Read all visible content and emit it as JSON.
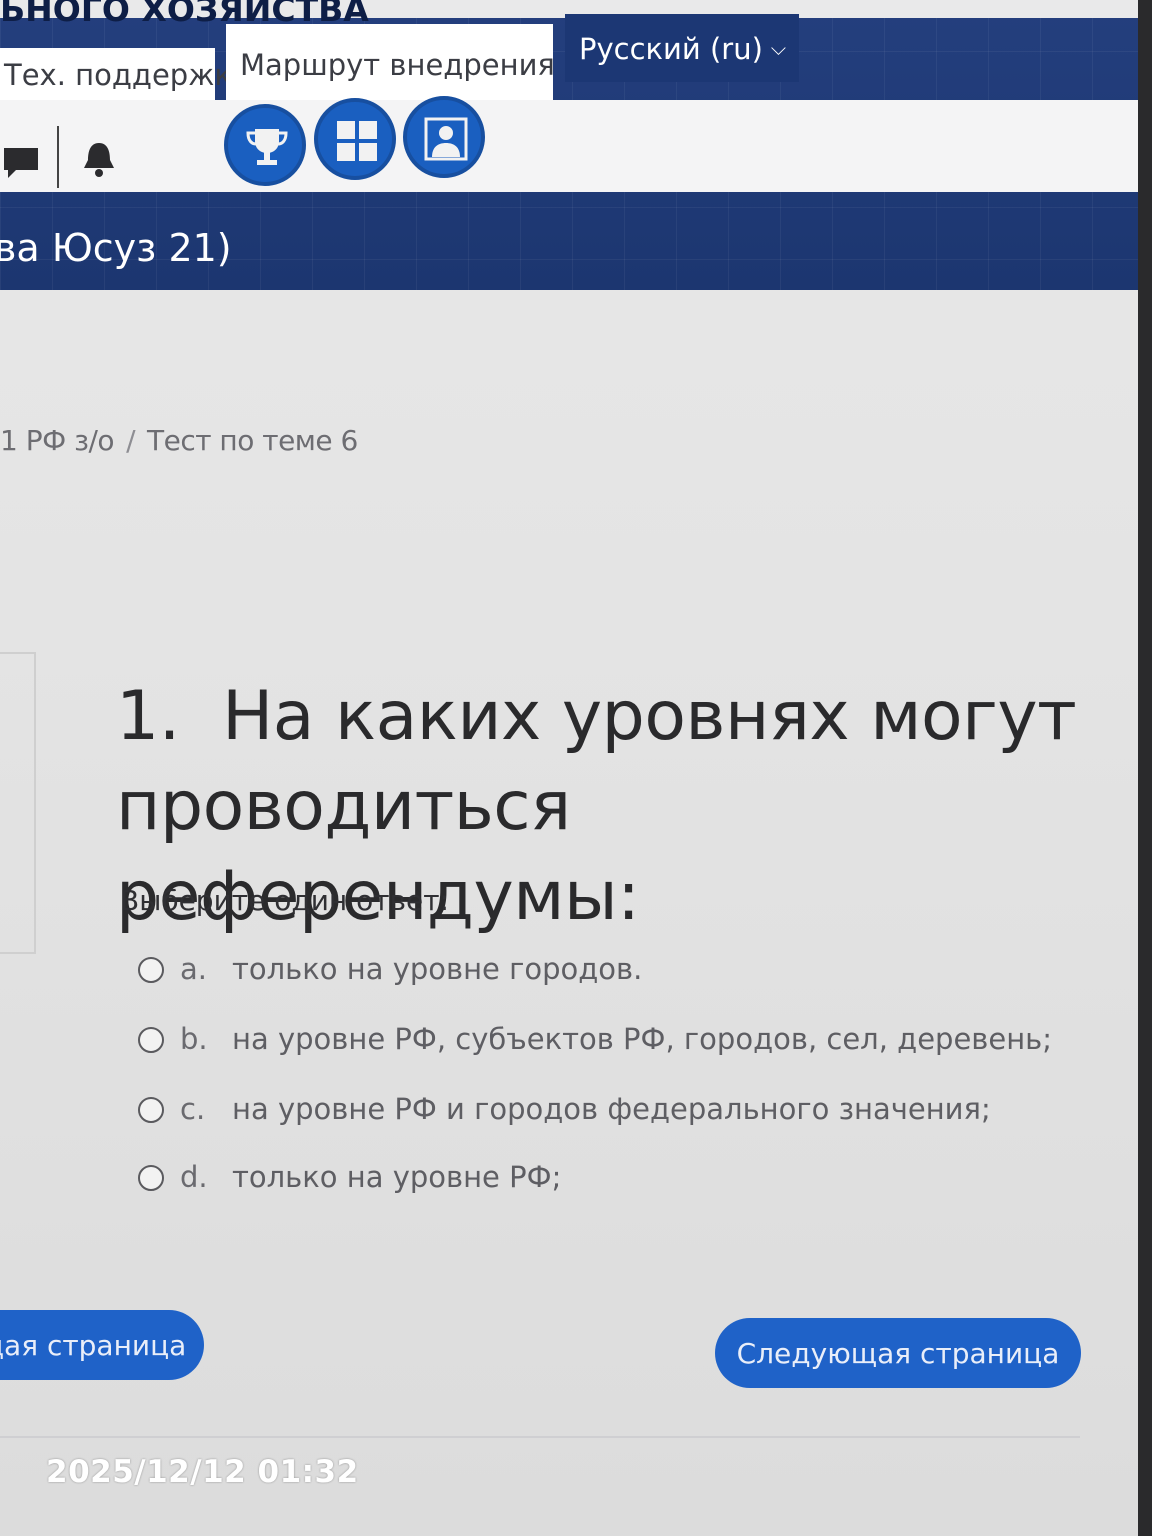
{
  "header": {
    "site_title": "ьного хозяйства",
    "tabs": {
      "support": "Тех. поддержка",
      "route": "Маршрут внедрения",
      "language": "Русский (ru)"
    },
    "course_name": "ва Юсуз 21)"
  },
  "toolbar": {
    "icons": [
      "chat-icon",
      "bell-icon",
      "trophy-icon",
      "grid-icon",
      "person-icon"
    ]
  },
  "breadcrumb": {
    "parent": "1 РФ з/о",
    "separator": "/",
    "current": "Тест по теме 6"
  },
  "question": {
    "number": "1.",
    "text": "На каких уровнях могут проводиться референдумы:",
    "prompt": "Выберите один ответ:",
    "options": [
      {
        "letter": "a.",
        "text": "только на уровне городов."
      },
      {
        "letter": "b.",
        "text": "на уровне РФ, субъектов РФ, городов, сел, деревень;"
      },
      {
        "letter": "c.",
        "text": "на уровне РФ и городов федерального значения;"
      },
      {
        "letter": "d.",
        "text": "только на уровне РФ;"
      }
    ]
  },
  "navigation": {
    "prev_label": "щая страница",
    "next_label": "Следующая страница"
  },
  "photo_overlay": {
    "timestamp": "2025/12/12 01:32"
  },
  "colors": {
    "header_bg": "#1f3a78",
    "accent_button": "#1f62c8",
    "content_bg": "#e6e6e6"
  }
}
